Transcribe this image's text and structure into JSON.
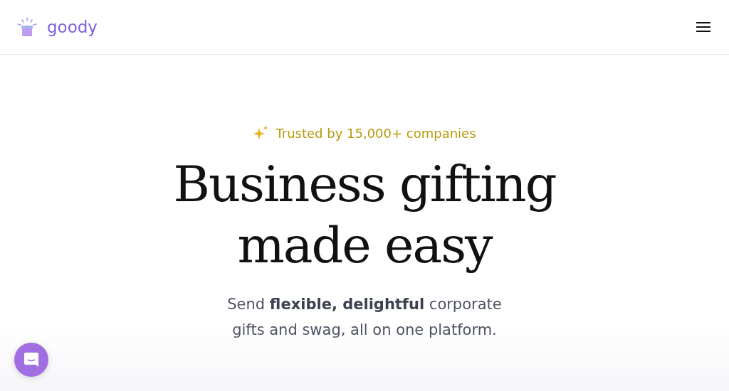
{
  "header": {
    "logo_text": "goody"
  },
  "hero": {
    "badge": "Trusted by 15,000+ companies",
    "headline_lines": [
      "Business gifting",
      "made easy"
    ],
    "subtitle": "Send **flexible, delightful** corporate gifts and swag, all on one platform."
  }
}
